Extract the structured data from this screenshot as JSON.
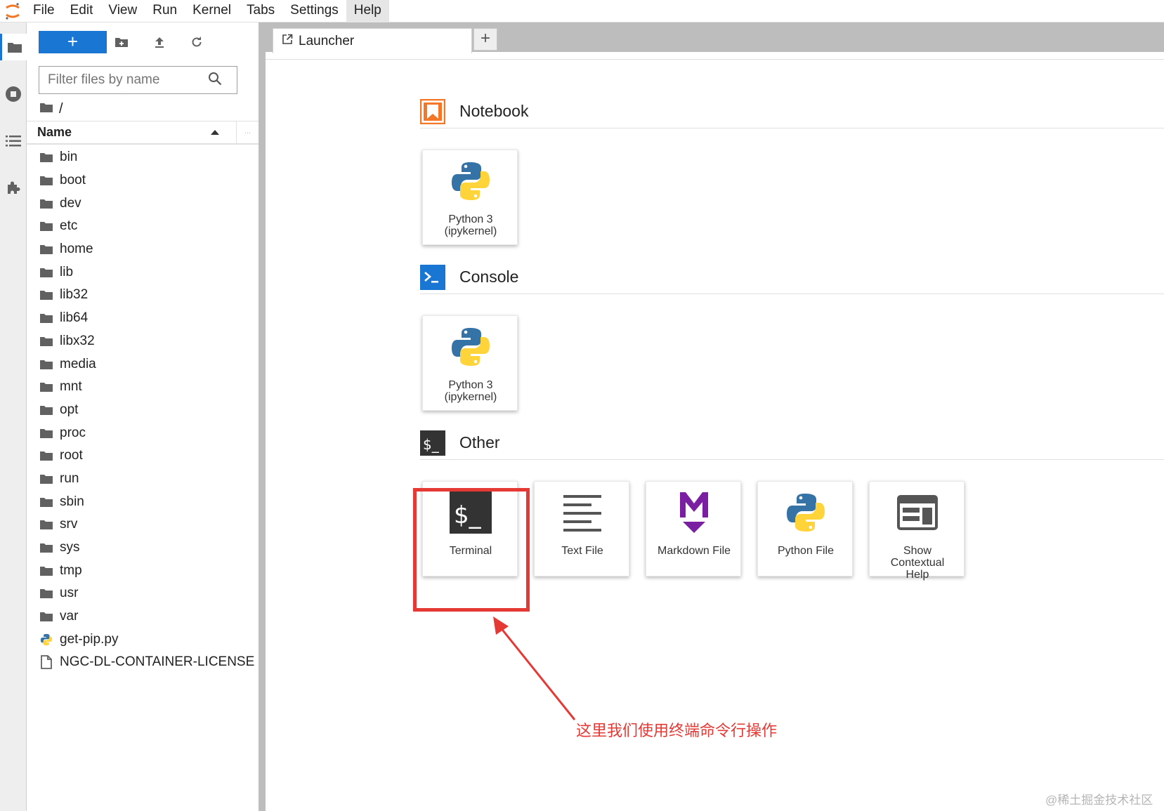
{
  "menubar": {
    "items": [
      "File",
      "Edit",
      "View",
      "Run",
      "Kernel",
      "Tabs",
      "Settings",
      "Help"
    ],
    "active_index": 7
  },
  "activity_bar": {
    "icons": [
      "folder-icon",
      "running-icon",
      "toc-icon",
      "extension-icon"
    ]
  },
  "file_browser": {
    "new_label": "+",
    "filter_placeholder": "Filter files by name",
    "breadcrumb": "/",
    "column_header": "Name",
    "column_more": "...",
    "files": [
      {
        "name": "bin",
        "type": "folder"
      },
      {
        "name": "boot",
        "type": "folder"
      },
      {
        "name": "dev",
        "type": "folder"
      },
      {
        "name": "etc",
        "type": "folder"
      },
      {
        "name": "home",
        "type": "folder"
      },
      {
        "name": "lib",
        "type": "folder"
      },
      {
        "name": "lib32",
        "type": "folder"
      },
      {
        "name": "lib64",
        "type": "folder"
      },
      {
        "name": "libx32",
        "type": "folder"
      },
      {
        "name": "media",
        "type": "folder"
      },
      {
        "name": "mnt",
        "type": "folder"
      },
      {
        "name": "opt",
        "type": "folder"
      },
      {
        "name": "proc",
        "type": "folder"
      },
      {
        "name": "root",
        "type": "folder"
      },
      {
        "name": "run",
        "type": "folder"
      },
      {
        "name": "sbin",
        "type": "folder"
      },
      {
        "name": "srv",
        "type": "folder"
      },
      {
        "name": "sys",
        "type": "folder"
      },
      {
        "name": "tmp",
        "type": "folder"
      },
      {
        "name": "usr",
        "type": "folder"
      },
      {
        "name": "var",
        "type": "folder"
      },
      {
        "name": "get-pip.py",
        "type": "python"
      },
      {
        "name": "NGC-DL-CONTAINER-LICENSE",
        "type": "file"
      }
    ]
  },
  "tabs": {
    "launcher_label": "Launcher",
    "add_label": "+"
  },
  "launcher": {
    "notebook": {
      "title": "Notebook",
      "cards": [
        {
          "line1": "Python 3",
          "line2": "(ipykernel)"
        }
      ]
    },
    "console": {
      "title": "Console",
      "cards": [
        {
          "line1": "Python 3",
          "line2": "(ipykernel)"
        }
      ]
    },
    "other": {
      "title": "Other",
      "cards": [
        {
          "line1": "Terminal",
          "line2": "",
          "line3": ""
        },
        {
          "line1": "Text File",
          "line2": "",
          "line3": ""
        },
        {
          "line1": "Markdown File",
          "line2": "",
          "line3": ""
        },
        {
          "line1": "Python File",
          "line2": "",
          "line3": ""
        },
        {
          "line1": "Show",
          "line2": "Contextual",
          "line3": "Help"
        }
      ]
    }
  },
  "annotation": {
    "text": "这里我们使用终端命令行操作",
    "color": "#e53935"
  },
  "watermark": "@稀土掘金技术社区",
  "colors": {
    "accent": "#1976d2",
    "notebook_orange": "#f37726",
    "console_blue": "#1976d2",
    "terminal_dark": "#333333",
    "markdown_purple": "#7b1fa2"
  }
}
